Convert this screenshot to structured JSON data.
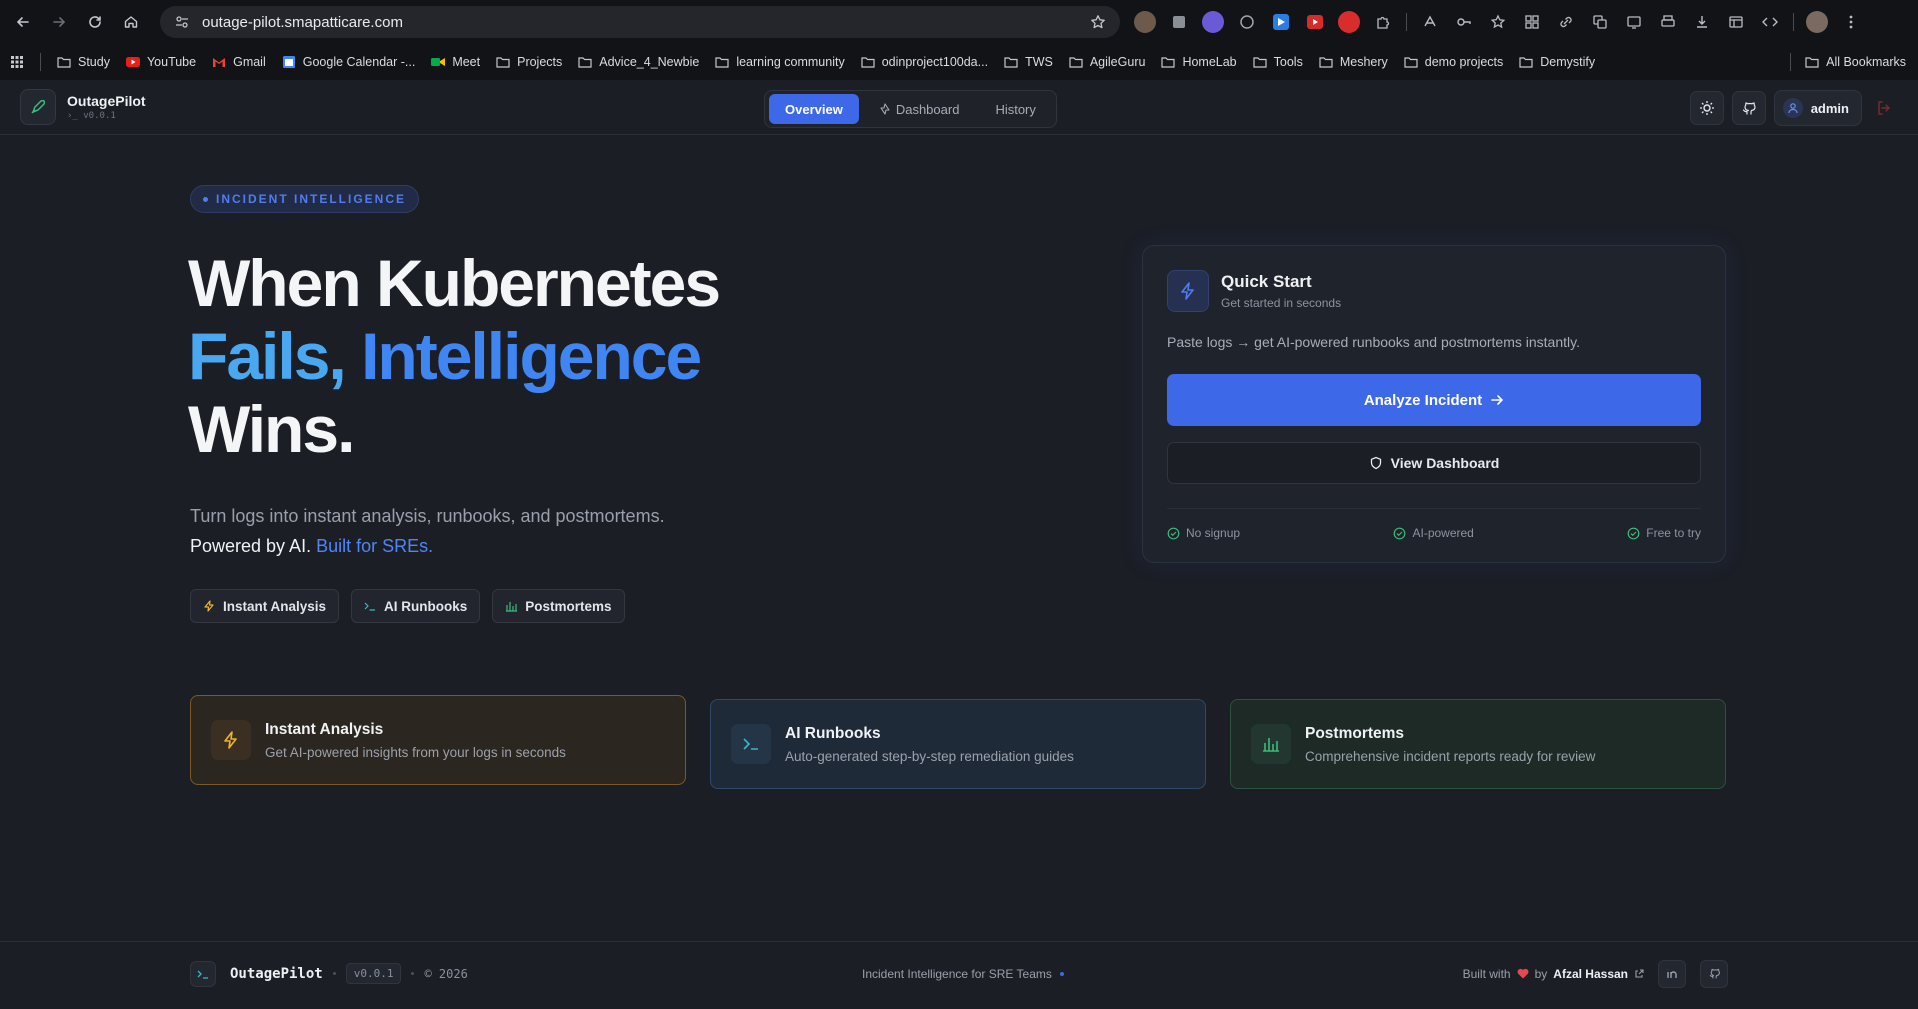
{
  "browser": {
    "url": "outage-pilot.smapatticare.com",
    "bookmarks": [
      "Study",
      "YouTube",
      "Gmail",
      "Google Calendar -...",
      "Meet",
      "Projects",
      "Advice_4_Newbie",
      "learning community",
      "odinproject100da...",
      "TWS",
      "AgileGuru",
      "HomeLab",
      "Tools",
      "Meshery",
      "demo projects",
      "Demystify"
    ],
    "all_bookmarks": "All Bookmarks"
  },
  "header": {
    "brand": "OutagePilot",
    "version": "v0.0.1",
    "tabs": [
      "Overview",
      "Dashboard",
      "History"
    ],
    "user": "admin"
  },
  "hero": {
    "badge": "INCIDENT INTELLIGENCE",
    "title_line1": "When Kubernetes",
    "title_word1": "Fails,",
    "title_word2": "Intelligence",
    "title_line3": "Wins.",
    "subtitle": "Turn logs into instant analysis, runbooks, and postmortems.",
    "powered": "Powered by AI.",
    "built": "Built for SREs.",
    "chips": [
      "Instant Analysis",
      "AI Runbooks",
      "Postmortems"
    ]
  },
  "quick_start": {
    "title": "Quick Start",
    "subtitle": "Get started in seconds",
    "description": "Paste logs → get AI-powered runbooks and postmortems instantly.",
    "primary": "Analyze Incident",
    "secondary": "View Dashboard",
    "features": [
      "No signup",
      "AI-powered",
      "Free to try"
    ]
  },
  "cards": [
    {
      "title": "Instant Analysis",
      "desc": "Get AI-powered insights from your logs in seconds"
    },
    {
      "title": "AI Runbooks",
      "desc": "Auto-generated step-by-step remediation guides"
    },
    {
      "title": "Postmortems",
      "desc": "Comprehensive incident reports ready for review"
    }
  ],
  "footer": {
    "name": "OutagePilot",
    "version": "v0.0.1",
    "copyright": "© 2026",
    "tagline": "Incident Intelligence for SRE Teams",
    "built_with": "Built with",
    "by": "by",
    "author": "Afzal Hassan"
  },
  "colors": {
    "accent": "#3d68e8",
    "orange": "#f0b429",
    "teal": "#3ab7c9",
    "green": "#3dbb7a",
    "heart": "#e5484d"
  }
}
